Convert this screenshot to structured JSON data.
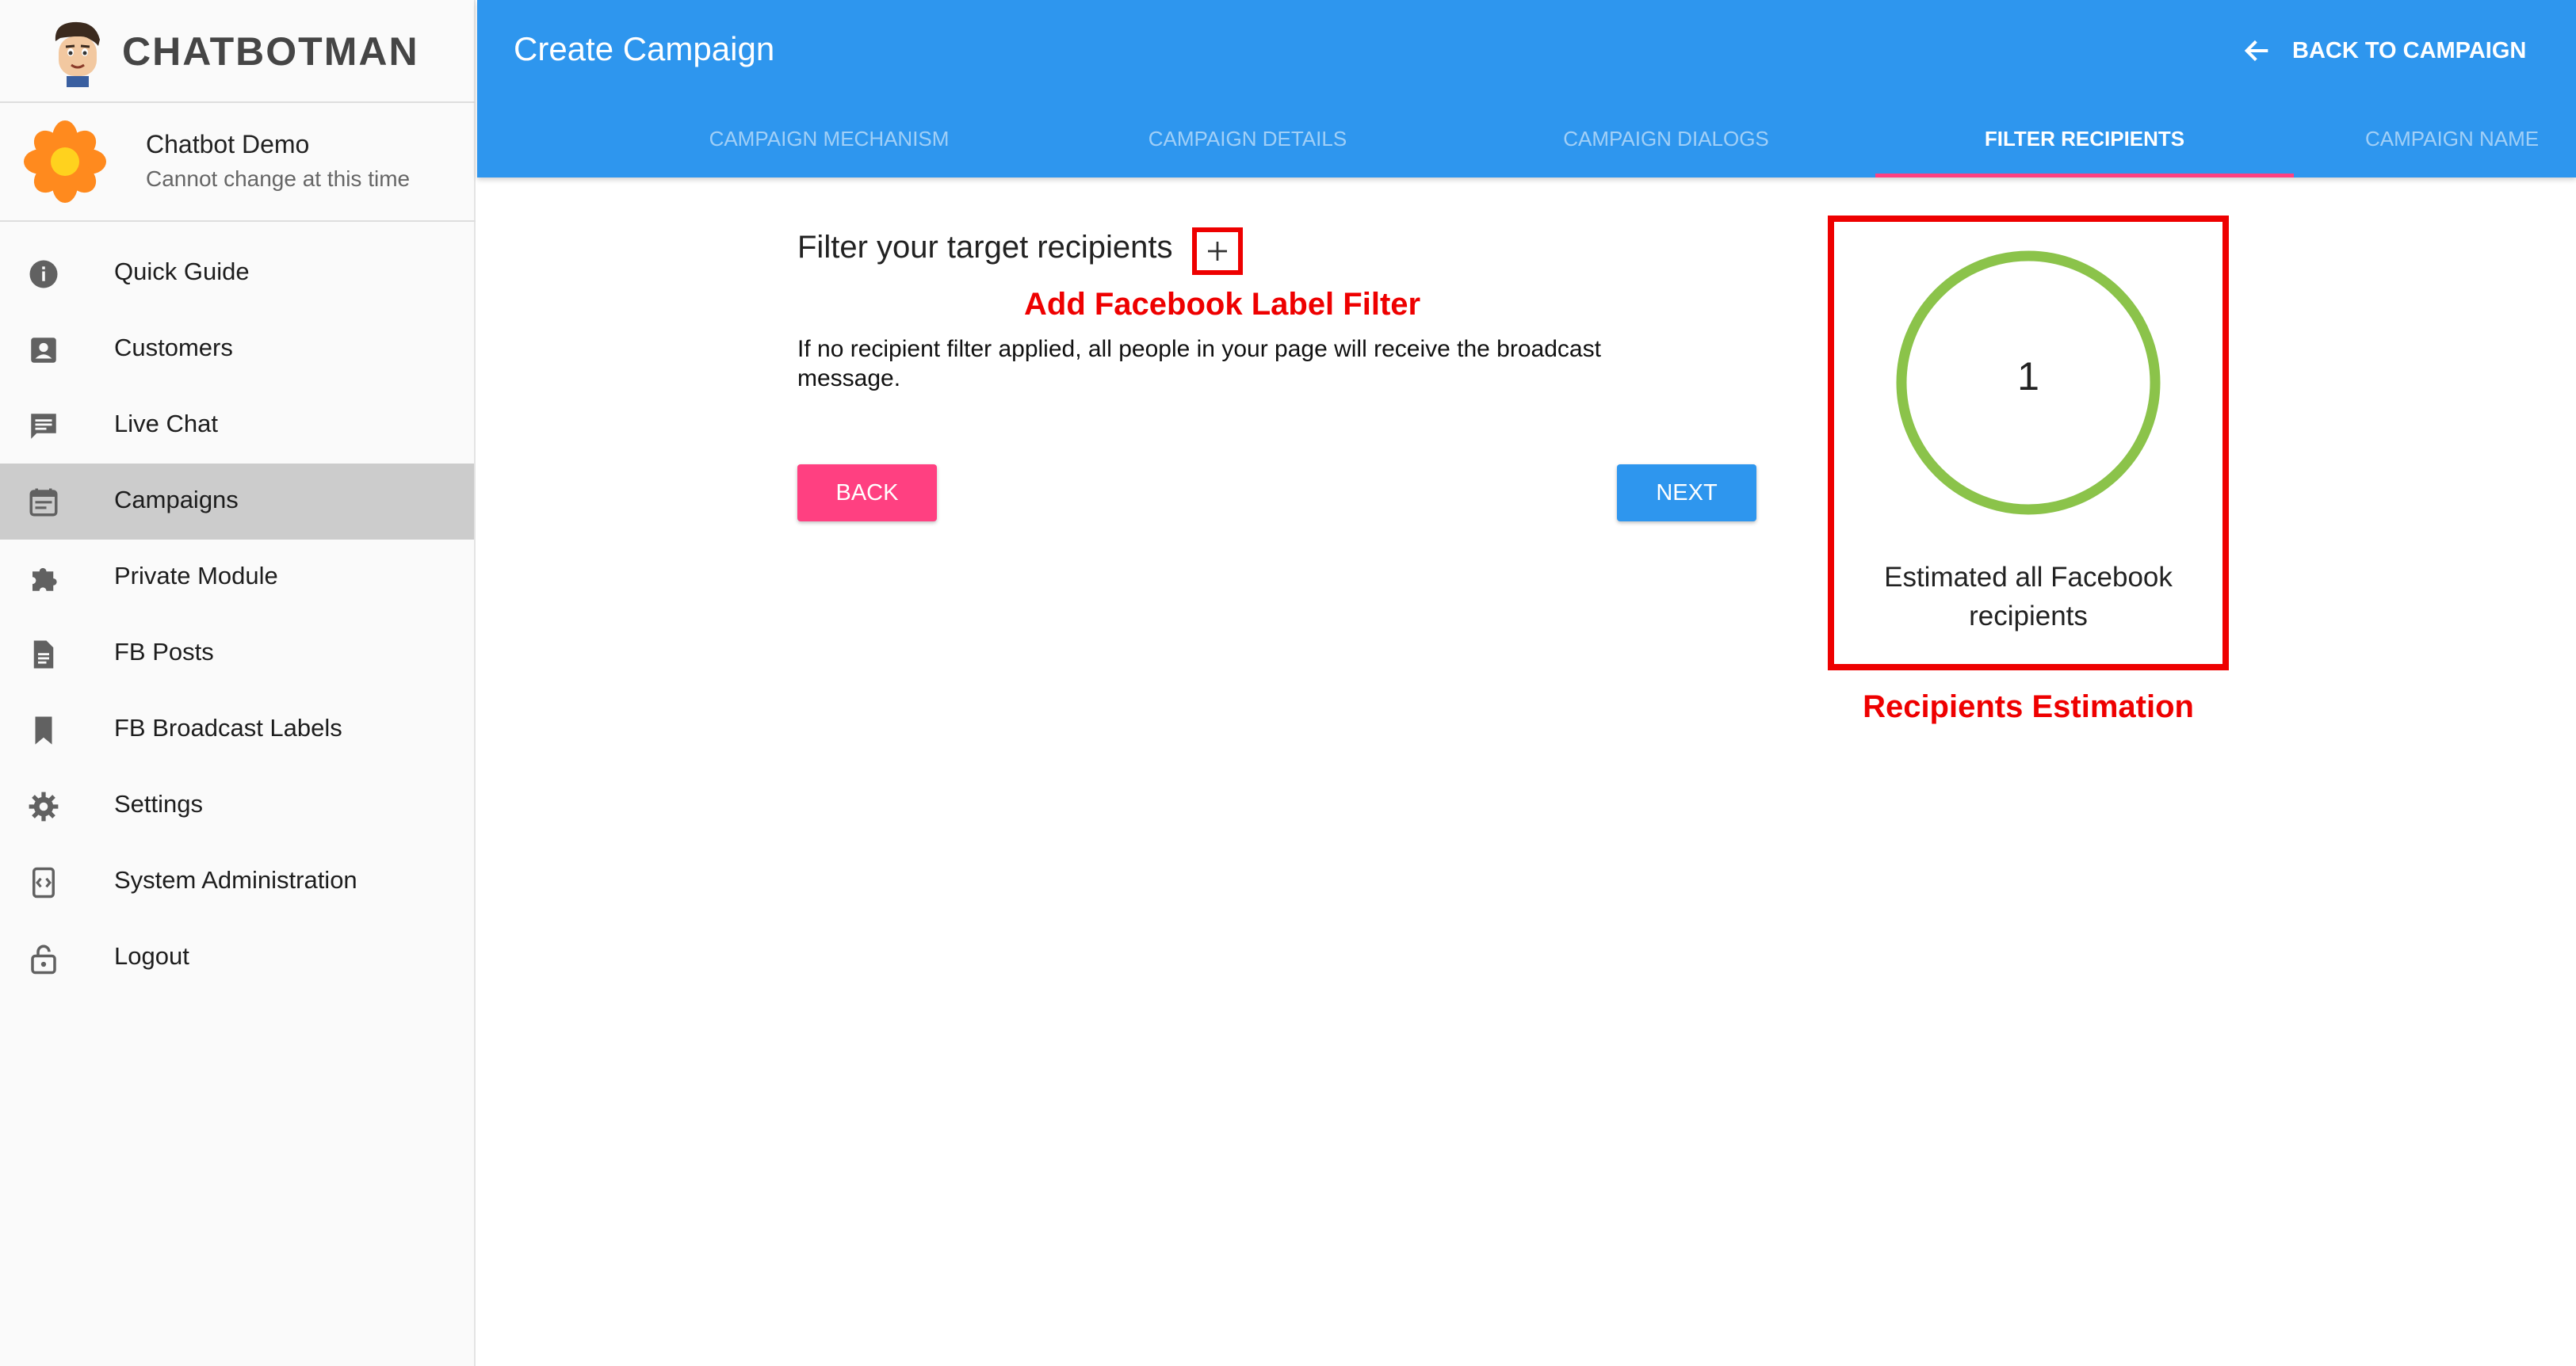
{
  "brand": {
    "name": "CHATBOTMAN"
  },
  "bot": {
    "name": "Chatbot Demo",
    "subtitle": "Cannot change at this time"
  },
  "sidebar": {
    "items": [
      {
        "label": "Quick Guide",
        "icon": "info-icon"
      },
      {
        "label": "Customers",
        "icon": "contact-card-icon"
      },
      {
        "label": "Live Chat",
        "icon": "chat-icon"
      },
      {
        "label": "Campaigns",
        "icon": "calendar-icon",
        "active": true
      },
      {
        "label": "Private Module",
        "icon": "puzzle-icon"
      },
      {
        "label": "FB Posts",
        "icon": "document-icon"
      },
      {
        "label": "FB Broadcast Labels",
        "icon": "bookmark-icon"
      },
      {
        "label": "Settings",
        "icon": "gear-icon"
      },
      {
        "label": "System Administration",
        "icon": "code-device-icon"
      },
      {
        "label": "Logout",
        "icon": "lock-icon"
      }
    ]
  },
  "header": {
    "title": "Create Campaign",
    "back_label": "BACK TO CAMPAIGN",
    "tabs": [
      {
        "label": "CAMPAIGN MECHANISM"
      },
      {
        "label": "CAMPAIGN DETAILS"
      },
      {
        "label": "CAMPAIGN DIALOGS"
      },
      {
        "label": "FILTER RECIPIENTS",
        "active": true
      },
      {
        "label": "CAMPAIGN NAME"
      }
    ]
  },
  "content": {
    "filter_title": "Filter your target recipients",
    "add_filter_annotation": "Add Facebook Label Filter",
    "note": "If no recipient filter applied, all people in your page will receive the broadcast message.",
    "back_button": "BACK",
    "next_button": "NEXT",
    "estimate": {
      "count": "1",
      "label": "Estimated all Facebook recipients",
      "annotation": "Recipients Estimation"
    }
  },
  "colors": {
    "primary": "#2e96ee",
    "accent": "#ff4081",
    "ring": "#8bc34a",
    "annotation": "#ee0000"
  }
}
